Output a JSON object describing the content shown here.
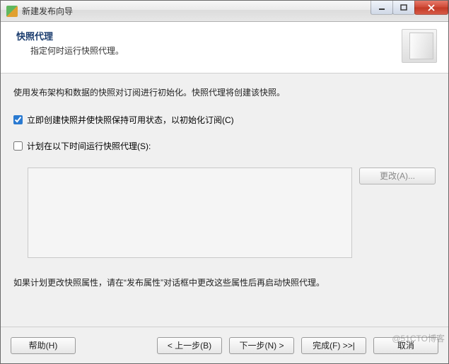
{
  "window": {
    "title": "新建发布向导"
  },
  "header": {
    "title": "快照代理",
    "subtitle": "指定何时运行快照代理。"
  },
  "content": {
    "intro": "使用发布架构和数据的快照对订阅进行初始化。快照代理将创建该快照。",
    "option_create_now": "立即创建快照并使快照保持可用状态，以初始化订阅(C)",
    "option_schedule": "计划在以下时间运行快照代理(S):",
    "change_btn": "更改(A)...",
    "footnote": "如果计划更改快照属性，请在“发布属性”对话框中更改这些属性后再启动快照代理。"
  },
  "footer": {
    "help": "帮助(H)",
    "back": "< 上一步(B)",
    "next": "下一步(N) >",
    "finish": "完成(F) >>|",
    "cancel": "取消"
  },
  "watermark": "@51CTO博客"
}
